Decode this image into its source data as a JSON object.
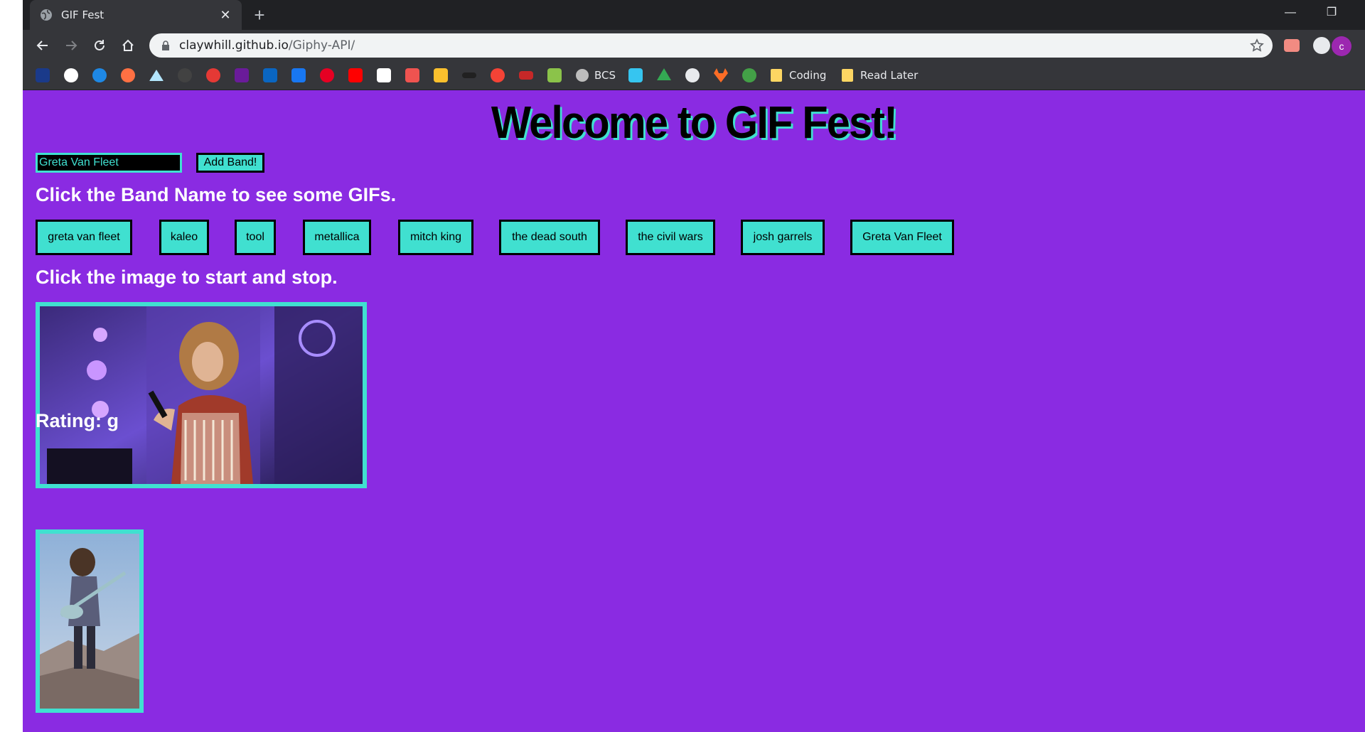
{
  "browser": {
    "tab_title": "GIF Fest",
    "url_host": "claywhill.github.io",
    "url_path": "/Giphy-API/",
    "profile_initial": "c"
  },
  "bookmarks": {
    "bcs_label": "BCS",
    "folder1_label": "Coding",
    "folder2_label": "Read Later"
  },
  "page": {
    "heading": "Welcome to GIF Fest!",
    "input_value": "Greta Van Fleet",
    "add_button": "Add Band!",
    "instructions_bands": "Click the Band Name to see some GIFs.",
    "instructions_image": "Click the image to start and stop.",
    "rating_label": "Rating: g"
  },
  "bands": [
    "greta van fleet",
    "kaleo",
    "tool",
    "metallica",
    "mitch king",
    "the dead south",
    "the civil wars",
    "josh garrels",
    "Greta Van Fleet"
  ],
  "colors": {
    "page_bg": "#8a2be2",
    "accent": "#40e0d0"
  }
}
